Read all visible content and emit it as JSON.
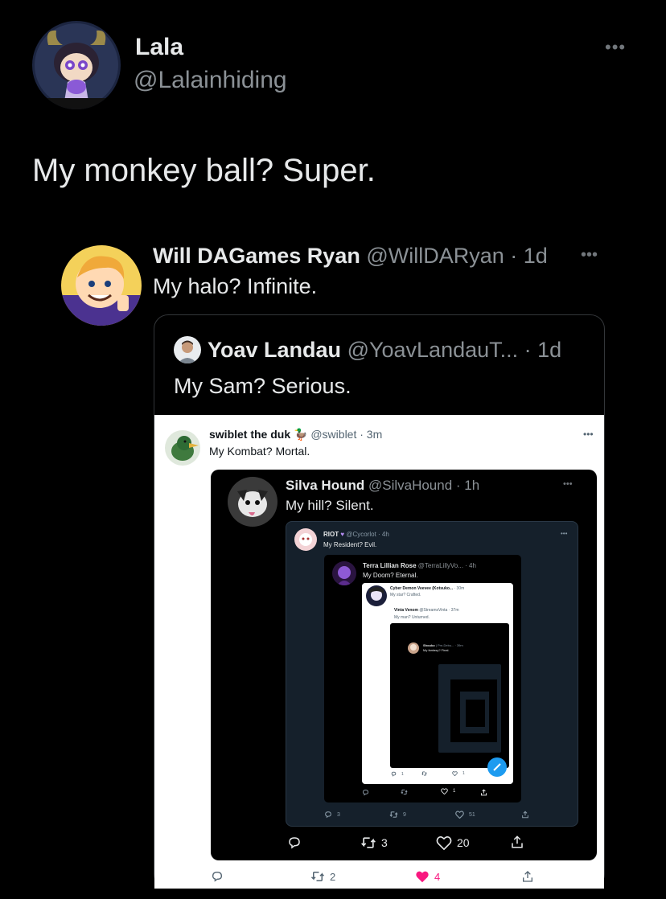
{
  "main_tweet": {
    "name": "Lala",
    "handle": "@Lalainhiding",
    "text": "My monkey ball? Super.",
    "more": "•••"
  },
  "reply": {
    "name": "Will DAGames Ryan",
    "handle_time": "@WillDARyan · 1d",
    "text": "My halo? Infinite.",
    "more": "•••"
  },
  "quote": {
    "name": "Yoav Landau",
    "handle_time": "@YoavLandauT... · 1d",
    "text": "My Sam? Serious."
  },
  "shot1": {
    "name": "swiblet the duk",
    "emoji": "🦆",
    "handle_time": "@swiblet · 3m",
    "text": "My Kombat? Mortal.",
    "more": "•••",
    "actions": {
      "replies": "",
      "retweets": "2",
      "likes": "4"
    }
  },
  "shot2": {
    "name": "Silva Hound",
    "handle_time": "@SilvaHound · 1h",
    "text": "My hill? Silent.",
    "more": "•••",
    "actions": {
      "replies": "",
      "retweets": "3",
      "likes": "20"
    }
  },
  "shot3": {
    "name": "RIOT",
    "handle_time": "@Cycorlot · 4h",
    "text": "My Resident? Evil.",
    "more": "•••",
    "actions": {
      "replies": "3",
      "retweets": "9",
      "likes": "51"
    }
  },
  "shot4": {
    "name": "Terra Lillian Rose",
    "handle_time": "@TerraLillyVo... · 4h",
    "text": "My Doom? Eternal.",
    "actions": {
      "replies": "",
      "retweets": "",
      "likes": "1"
    }
  },
  "shot5": {
    "name": "Cyber Demon Veevee (Kotsuko...",
    "handle_time": "· 30m",
    "text": "My star? Crafted.",
    "actions": {
      "replies": "1",
      "retweets": "",
      "likes": "1"
    }
  },
  "shot6": {
    "name": "Vinta Venom",
    "handle_time": "@StreamsVinta · 37m",
    "text": "My man? Unturned."
  },
  "shot7": {
    "name": "Shouko",
    "handle_time": "| Pre-Debu... · 39m",
    "text": "My fantasy? Final."
  },
  "colors": {
    "background": "#000000",
    "text_primary": "#e7e9ea",
    "text_secondary": "#8b9196",
    "like_pink": "#f91880",
    "twitter_blue": "#1d9bf0",
    "dim_navy": "#15202b"
  }
}
